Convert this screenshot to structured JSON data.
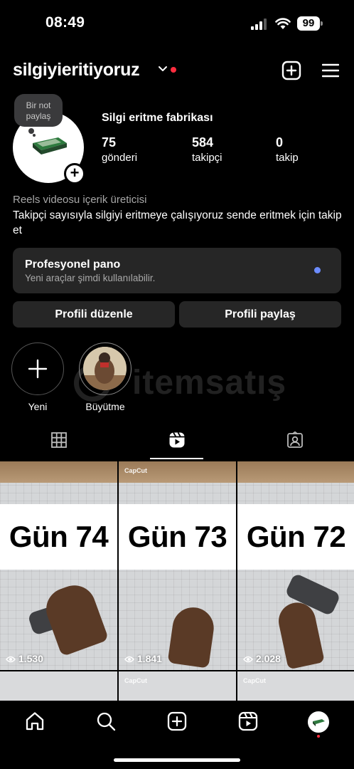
{
  "status_bar": {
    "time": "08:49",
    "battery": "99"
  },
  "header": {
    "username": "silgiyieritiyoruz"
  },
  "note": {
    "text": "Bir not paylaş"
  },
  "profile": {
    "display_name": "Silgi eritme fabrikası",
    "stats": [
      {
        "value": "75",
        "label": "gönderi"
      },
      {
        "value": "584",
        "label": "takipçi"
      },
      {
        "value": "0",
        "label": "takip"
      }
    ],
    "category": "Reels videosu içerik üreticisi",
    "bio": "Takipçi sayısıyla silgiyi eritmeye çalışıyoruz sende eritmek için takip et"
  },
  "dashboard": {
    "title": "Profesyonel pano",
    "subtitle": "Yeni araçlar şimdi kullanılabilir."
  },
  "buttons": {
    "edit": "Profili düzenle",
    "share": "Profili paylaş"
  },
  "highlights": [
    {
      "label": "Yeni"
    },
    {
      "label": "Büyütme"
    }
  ],
  "watermark": {
    "text": "itemsatış"
  },
  "reels": [
    {
      "title": "Gün 74",
      "views": "1.530",
      "tag": ""
    },
    {
      "title": "Gün 73",
      "views": "1.841",
      "tag": "CapCut"
    },
    {
      "title": "Gün 72",
      "views": "2.028",
      "tag": ""
    }
  ],
  "reels_row2": [
    {
      "tag": ""
    },
    {
      "tag": "CapCut"
    },
    {
      "tag": "CapCut"
    }
  ],
  "colors": {
    "background": "#000000",
    "surface": "#262626",
    "accent_dot": "#ff2d3f",
    "info_dot": "#6c8cff"
  },
  "icons": [
    "signal-icon",
    "wifi-icon",
    "battery-icon",
    "chevron-down-icon",
    "create-icon",
    "menu-icon",
    "grid-icon",
    "reels-icon",
    "tagged-icon",
    "home-icon",
    "search-icon",
    "new-post-icon",
    "reels-nav-icon",
    "eye-icon"
  ]
}
